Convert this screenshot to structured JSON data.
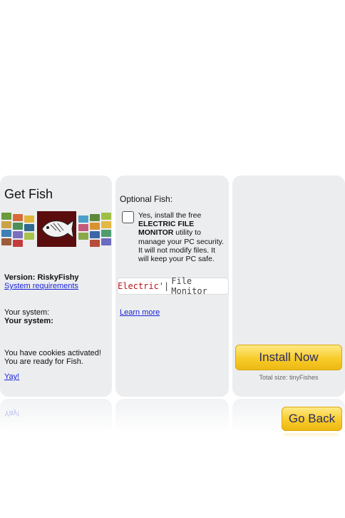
{
  "left_panel": {
    "title": "Get Fish",
    "version_label": "Version: RiskyFishy",
    "system_requirements_link": "System requirements",
    "your_system_1": "Your system:",
    "your_system_2": "Your system:",
    "cookies_line1": "You have cookies activated!",
    "cookies_line2": "You are ready for Fish.",
    "yay_link": "Yay!"
  },
  "middle_panel": {
    "title": "Optional Fish:",
    "offer_line1": "Yes, install the free",
    "offer_bold_1": "ELECTRIC FILE",
    "offer_bold_2": "MONITOR",
    "offer_rest_1": " utility to",
    "offer_line4": "manage your PC security.",
    "offer_line5": "It will not modify files. It",
    "offer_line6": "will keep your PC safe.",
    "banner_red": "Electric",
    "banner_sep": "'|",
    "banner_gray": "File Monitor",
    "learn_more_link": "Learn more",
    "checkbox_checked": false
  },
  "right_panel": {
    "install_button": "Install Now",
    "total_size": "Total size: tinyFishes"
  },
  "bottom": {
    "go_back_button": "Go Back"
  },
  "colors": {
    "panel_bg": "#ecedef",
    "button_gold": "#f7cc2a",
    "link_blue": "#1a24d6",
    "banner_red": "#b8141c"
  }
}
